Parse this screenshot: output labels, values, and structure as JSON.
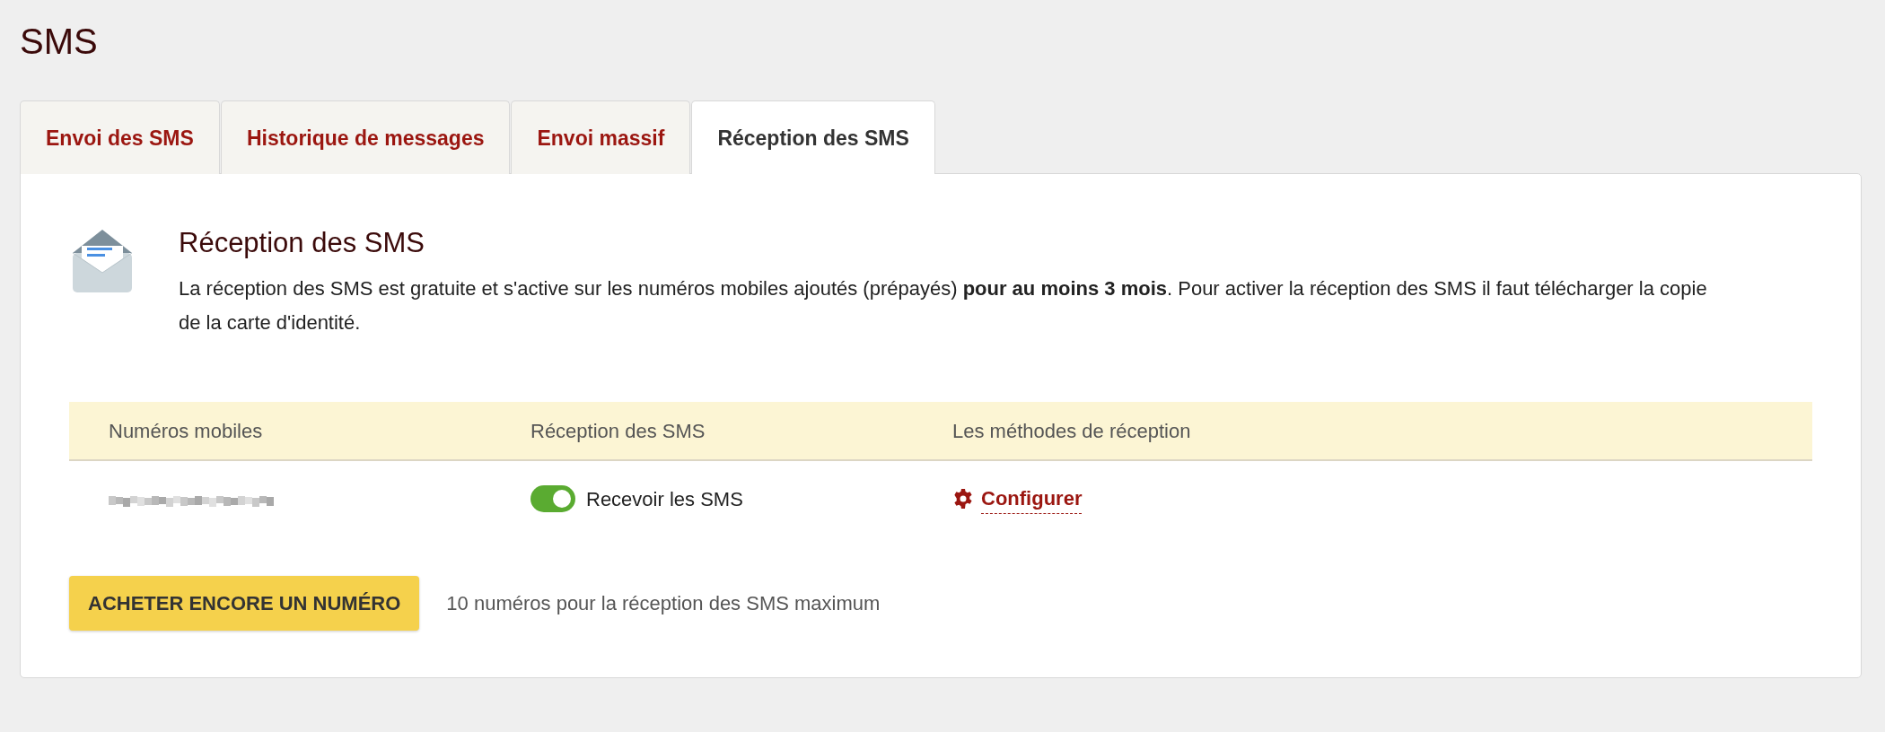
{
  "page_title": "SMS",
  "tabs": [
    {
      "label": "Envoi des SMS",
      "selected": false
    },
    {
      "label": "Historique de messages",
      "selected": false
    },
    {
      "label": "Envoi massif",
      "selected": false
    },
    {
      "label": "Réception des SMS",
      "selected": true
    }
  ],
  "section": {
    "heading": "Réception des SMS",
    "description": "La réception des SMS est gratuite et s'active sur les numéros mobiles ajoutés (prépayés) **pour au moins 3 mois**. Pour activer la réception des SMS il faut télécharger la copie de la carte d'identité."
  },
  "table": {
    "columns": [
      "Numéros mobiles",
      "Réception des SMS",
      "Les méthodes de réception"
    ],
    "rows": [
      {
        "number_redacted": true,
        "toggle": {
          "label": "Recevoir les SMS",
          "on": true
        },
        "action": "Configurer"
      }
    ]
  },
  "buy_button": "ACHETER ENCORE UN NUMÉRO",
  "limit_note": "10 numéros pour la réception des SMS maximum"
}
